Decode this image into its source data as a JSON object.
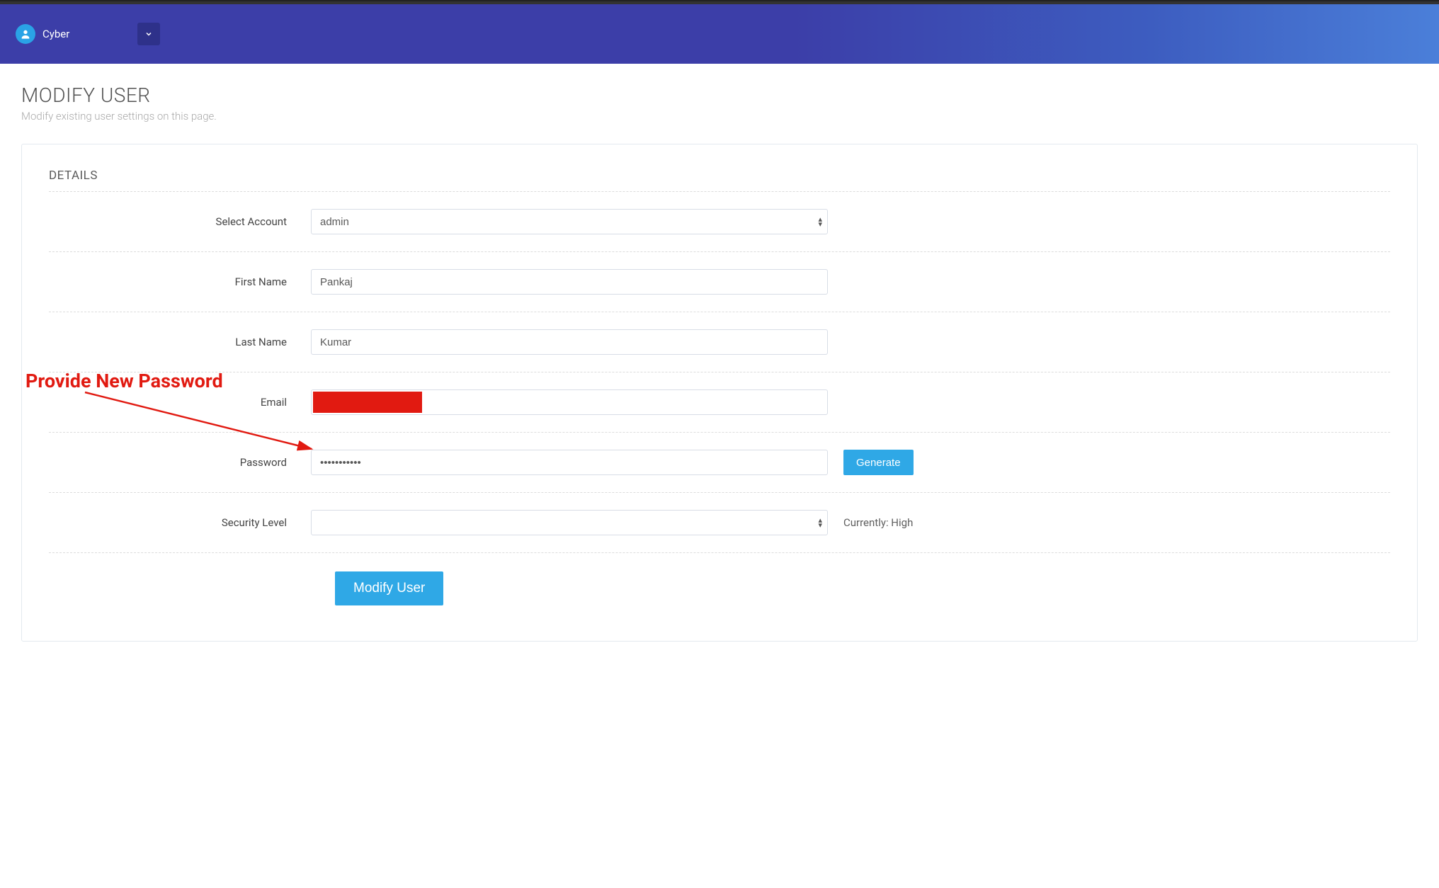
{
  "header": {
    "brand": "Cyber"
  },
  "page": {
    "title": "MODIFY USER",
    "subtitle": "Modify existing user settings on this page."
  },
  "panel": {
    "heading": "DETAILS"
  },
  "form": {
    "account": {
      "label": "Select Account",
      "value": "admin"
    },
    "first_name": {
      "label": "First Name",
      "value": "Pankaj"
    },
    "last_name": {
      "label": "Last Name",
      "value": "Kumar"
    },
    "email": {
      "label": "Email",
      "value": ""
    },
    "password": {
      "label": "Password",
      "value": "•••••••••••",
      "generate_label": "Generate"
    },
    "security": {
      "label": "Security Level",
      "value": "",
      "aux": "Currently: High"
    },
    "submit_label": "Modify User"
  },
  "annotation": {
    "text": "Provide New Password"
  }
}
